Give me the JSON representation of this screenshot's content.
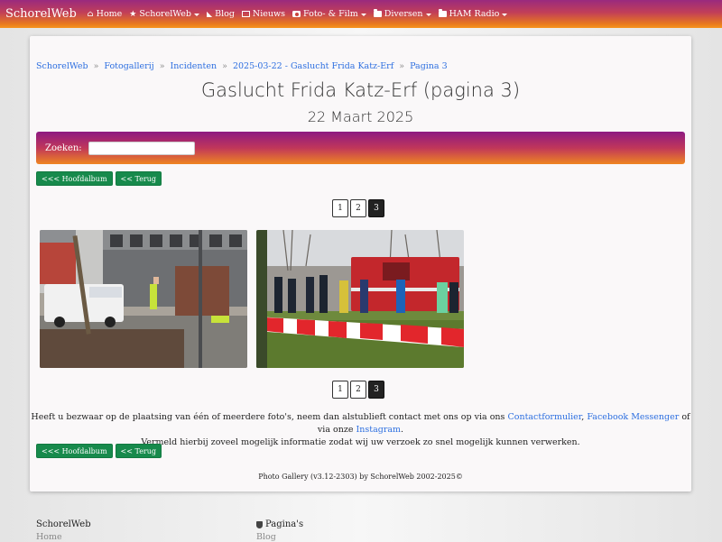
{
  "navbar": {
    "brand": "SchorelWeb",
    "items": [
      {
        "label": "Home",
        "icon": "home-icon",
        "dropdown": false
      },
      {
        "label": "SchorelWeb",
        "icon": "star-icon",
        "dropdown": true
      },
      {
        "label": "Blog",
        "icon": "rss-icon",
        "dropdown": false
      },
      {
        "label": "Nieuws",
        "icon": "newspaper-icon",
        "dropdown": false
      },
      {
        "label": "Foto- & Film",
        "icon": "camera-icon",
        "dropdown": true
      },
      {
        "label": "Diversen",
        "icon": "folder-icon",
        "dropdown": true
      },
      {
        "label": "HAM Radio",
        "icon": "folder-icon",
        "dropdown": true
      }
    ]
  },
  "breadcrumb": [
    "SchorelWeb",
    "Fotogallerij",
    "Incidenten",
    "2025-03-22 - Gaslucht Frida Katz-Erf",
    "Pagina 3"
  ],
  "page": {
    "title": "Gaslucht Frida Katz-Erf (pagina 3)",
    "date": "22 Maart 2025"
  },
  "search": {
    "label": "Zoeken:",
    "value": ""
  },
  "buttons": {
    "main_album": "<<< Hoofdalbum",
    "back": "<< Terug"
  },
  "pagination": {
    "pages": [
      "1",
      "2",
      "3"
    ],
    "current": "3"
  },
  "notice": {
    "line1_prefix": "Heeft u bezwaar op de plaatsing van één of meerdere foto's, neem dan alstublieft contact met ons op via ons",
    "contact_link": "Contactformulier",
    "sep": ",",
    "messenger_link": "Facebook Messenger",
    "mid": "of via onze",
    "instagram_link": "Instagram",
    "end": ".",
    "line2": "Vermeld hierbij zoveel mogelijk informatie zodat wij uw verzoek zo snel mogelijk kunnen verwerken."
  },
  "credit": "Photo Gallery (v3.12-2303) by SchorelWeb 2002-2025©",
  "footer": {
    "col1": {
      "heading": "SchorelWeb",
      "link": "Home"
    },
    "col2": {
      "heading": "Pagina's",
      "link": "Blog"
    }
  },
  "colors": {
    "accent_link": "#2d6fe0",
    "button_green": "#178a4c",
    "gradient_start": "#8d1a82",
    "gradient_end": "#f7941d"
  }
}
